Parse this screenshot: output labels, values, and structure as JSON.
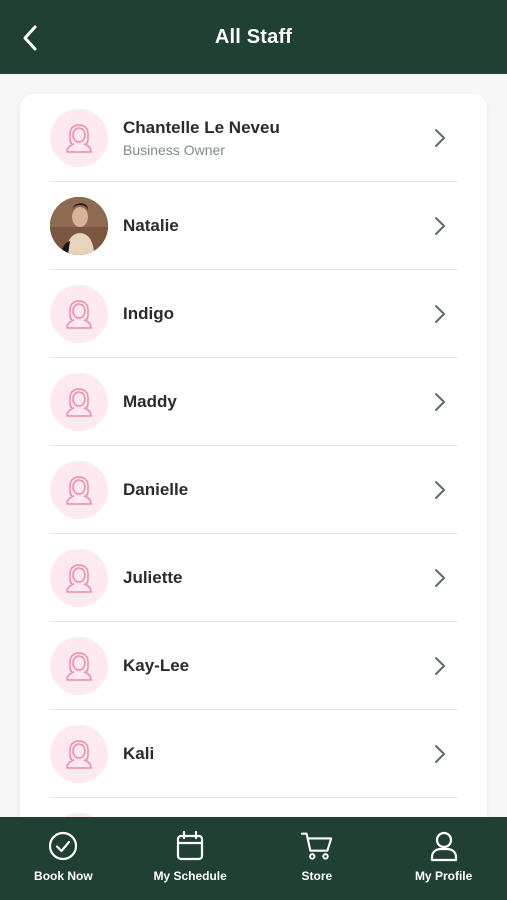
{
  "header": {
    "title": "All Staff",
    "back_icon": "chevron-left-icon"
  },
  "staff": [
    {
      "name": "Chantelle Le Neveu",
      "role": "Business Owner",
      "avatar": "placeholder"
    },
    {
      "name": "Natalie",
      "role": "",
      "avatar": "photo"
    },
    {
      "name": "Indigo",
      "role": "",
      "avatar": "placeholder"
    },
    {
      "name": "Maddy",
      "role": "",
      "avatar": "placeholder"
    },
    {
      "name": "Danielle",
      "role": "",
      "avatar": "placeholder"
    },
    {
      "name": "Juliette",
      "role": "",
      "avatar": "placeholder"
    },
    {
      "name": "Kay-Lee",
      "role": "",
      "avatar": "placeholder"
    },
    {
      "name": "Kali",
      "role": "",
      "avatar": "placeholder"
    }
  ],
  "tabbar": {
    "tabs": [
      {
        "label": "Book Now",
        "icon": "check-circle-icon"
      },
      {
        "label": "My Schedule",
        "icon": "calendar-icon"
      },
      {
        "label": "Store",
        "icon": "cart-icon"
      },
      {
        "label": "My Profile",
        "icon": "user-icon"
      }
    ]
  },
  "colors": {
    "brand": "#1f4033",
    "avatar_bg": "#fde9ef",
    "avatar_line": "#e88aa6"
  }
}
